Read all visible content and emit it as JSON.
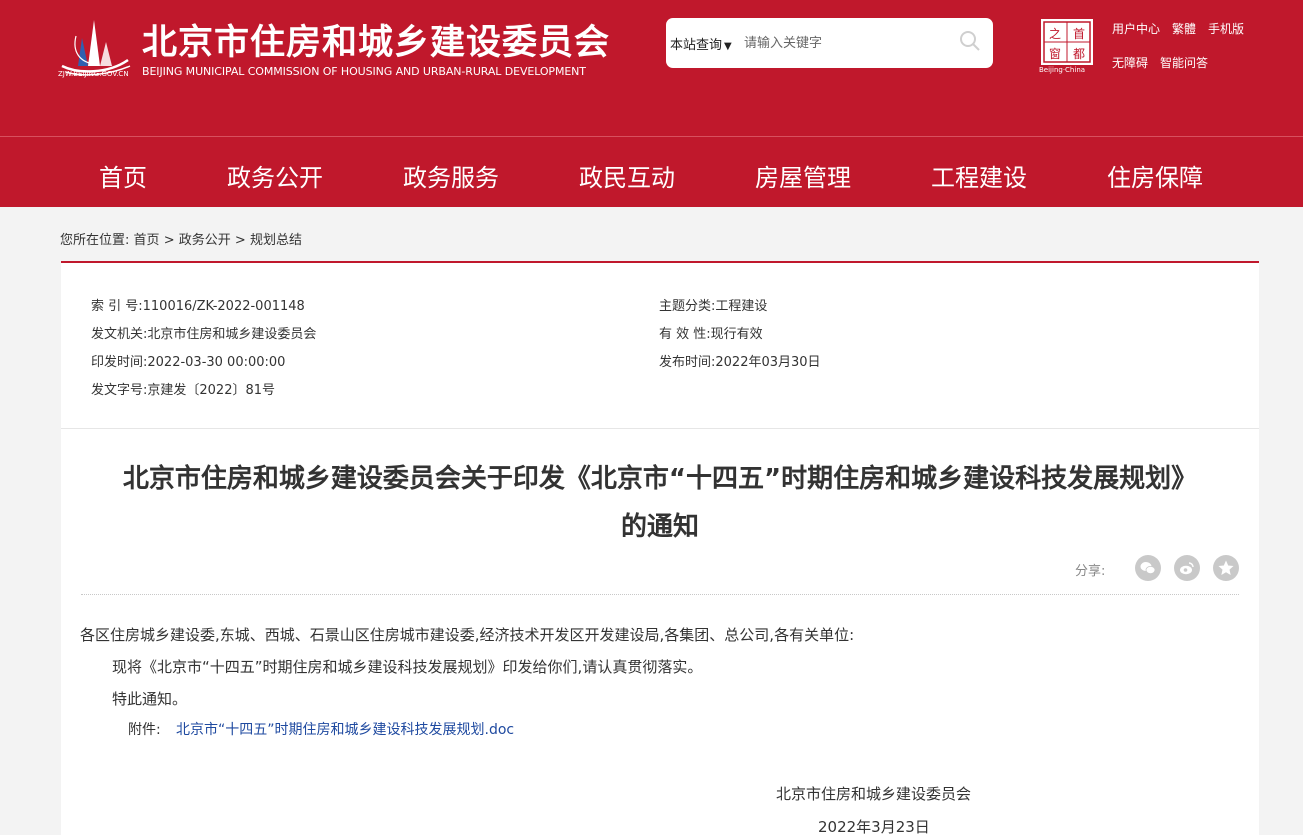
{
  "header": {
    "site_name_cn": "北京市住房和城乡建设委员会",
    "site_name_en": "BEIJING MUNICIPAL COMMISSION OF HOUSING AND URBAN-RURAL DEVELOPMENT",
    "site_url": "ZJW.BEIJING.GOV.CN",
    "search": {
      "scope": "本站查询",
      "placeholder": "请输入关键字"
    },
    "capital_logo_sub": "Beijing·China",
    "links": [
      "用户中心",
      "繁體",
      "手机版",
      "无障碍",
      "智能问答"
    ]
  },
  "nav": {
    "items": [
      "首页",
      "政务公开",
      "政务服务",
      "政民互动",
      "房屋管理",
      "工程建设",
      "住房保障"
    ]
  },
  "breadcrumb": {
    "prefix": "您所在位置:",
    "items": [
      "首页",
      "政务公开",
      "规划总结"
    ],
    "separator": ">"
  },
  "meta": {
    "index_no": "索 引 号:110016/ZK-2022-001148",
    "issuer": "发文机关:北京市住房和城乡建设委员会",
    "print_date": "印发时间:2022-03-30 00:00:00",
    "doc_no": "发文字号:京建发〔2022〕81号",
    "topic": "主题分类:工程建设",
    "validity": "有 效 性:现行有效",
    "publish_date": "发布时间:2022年03月30日"
  },
  "article": {
    "title_line1": "北京市住房和城乡建设委员会关于印发《北京市“十四五”时期住房和城乡建设科技发展规划》",
    "title_line2": "的通知",
    "share_label": "分享:",
    "salutation": "各区住房城乡建设委,东城、西城、石景山区住房城市建设委,经济技术开发区开发建设局,各集团、总公司,各有关单位:",
    "para1": "现将《北京市“十四五”时期住房和城乡建设科技发展规划》印发给你们,请认真贯彻落实。",
    "para2": "特此通知。",
    "attachment_label": "附件:",
    "attachment_link": "北京市“十四五”时期住房和城乡建设科技发展规划.doc",
    "signer": "北京市住房和城乡建设委员会",
    "sign_date": "2022年3月23日"
  },
  "colors": {
    "brand_red": "#c0182c",
    "link_blue": "#1f4aa0"
  }
}
